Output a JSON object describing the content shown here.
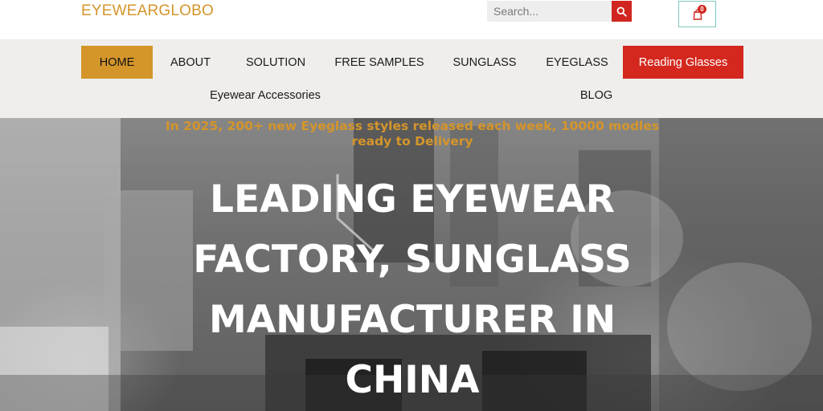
{
  "header": {
    "logo": "EYEWEARGLOBO",
    "search_placeholder": "Search...",
    "search_icon": "search-icon",
    "cart_icon": "shopping-bag-icon",
    "cart_count": "0"
  },
  "nav": {
    "items": [
      {
        "label": "HOME",
        "active": true
      },
      {
        "label": "ABOUT"
      },
      {
        "label": "SOLUTION"
      },
      {
        "label": "FREE SAMPLES"
      },
      {
        "label": "SUNGLASS"
      },
      {
        "label": "EYEGLASS"
      },
      {
        "label": "Reading Glasses",
        "highlight": true
      },
      {
        "label": "Eyewear Accessories"
      },
      {
        "label": "BLOG"
      }
    ]
  },
  "hero": {
    "announcement": "In 2025, 200+ new Eyeglass styles released each week, 10000 modles ready to Delivery",
    "headline": "LEADING EYEWEAR FACTORY, SUNGLASS MANUFACTURER IN CHINA"
  },
  "colors": {
    "brand_gold": "#d4952b",
    "accent_red": "#d4281f",
    "nav_bg": "#efeeec"
  }
}
